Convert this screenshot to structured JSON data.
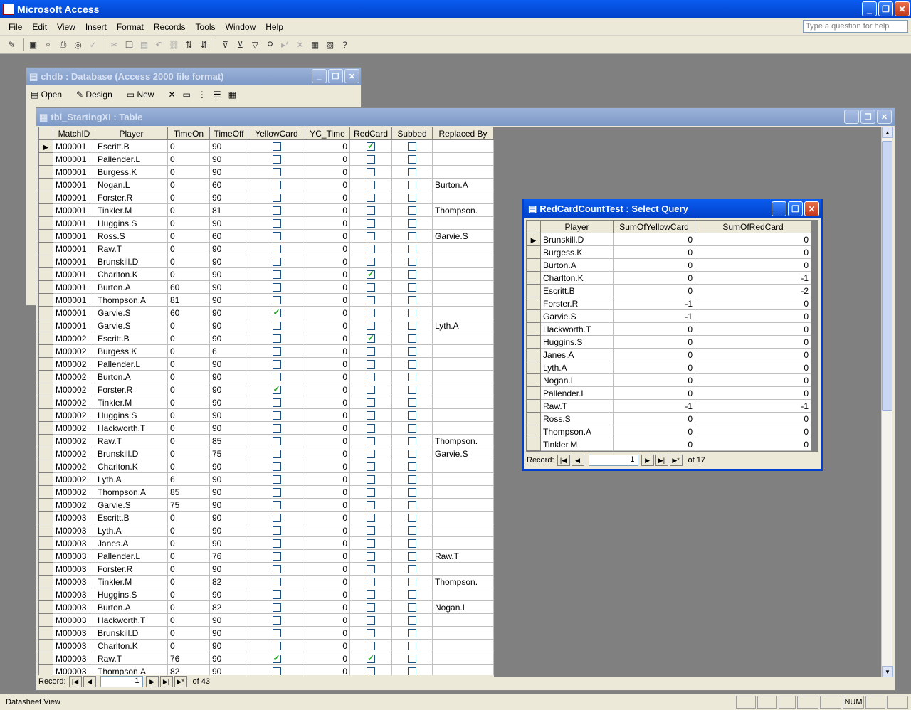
{
  "app": {
    "title": "Microsoft Access"
  },
  "menu": [
    "File",
    "Edit",
    "View",
    "Insert",
    "Format",
    "Records",
    "Tools",
    "Window",
    "Help"
  ],
  "help_placeholder": "Type a question for help",
  "db_window": {
    "title": "chdb : Database (Access 2000 file format)",
    "toolbar": {
      "open": "Open",
      "design": "Design",
      "new": "New"
    }
  },
  "table_window": {
    "title": "tbl_StartingXI : Table",
    "columns": [
      "MatchID",
      "Player",
      "TimeOn",
      "TimeOff",
      "YellowCard",
      "YC_Time",
      "RedCard",
      "Subbed",
      "Replaced By"
    ],
    "rows": [
      [
        "M00001",
        "Escritt.B",
        "0",
        "90",
        false,
        "0",
        true,
        false,
        ""
      ],
      [
        "M00001",
        "Pallender.L",
        "0",
        "90",
        false,
        "0",
        false,
        false,
        ""
      ],
      [
        "M00001",
        "Burgess.K",
        "0",
        "90",
        false,
        "0",
        false,
        false,
        ""
      ],
      [
        "M00001",
        "Nogan.L",
        "0",
        "60",
        false,
        "0",
        false,
        false,
        "Burton.A"
      ],
      [
        "M00001",
        "Forster.R",
        "0",
        "90",
        false,
        "0",
        false,
        false,
        ""
      ],
      [
        "M00001",
        "Tinkler.M",
        "0",
        "81",
        false,
        "0",
        false,
        false,
        "Thompson."
      ],
      [
        "M00001",
        "Huggins.S",
        "0",
        "90",
        false,
        "0",
        false,
        false,
        ""
      ],
      [
        "M00001",
        "Ross.S",
        "0",
        "60",
        false,
        "0",
        false,
        false,
        "Garvie.S"
      ],
      [
        "M00001",
        "Raw.T",
        "0",
        "90",
        false,
        "0",
        false,
        false,
        ""
      ],
      [
        "M00001",
        "Brunskill.D",
        "0",
        "90",
        false,
        "0",
        false,
        false,
        ""
      ],
      [
        "M00001",
        "Charlton.K",
        "0",
        "90",
        false,
        "0",
        true,
        false,
        ""
      ],
      [
        "M00001",
        "Burton.A",
        "60",
        "90",
        false,
        "0",
        false,
        false,
        ""
      ],
      [
        "M00001",
        "Thompson.A",
        "81",
        "90",
        false,
        "0",
        false,
        false,
        ""
      ],
      [
        "M00001",
        "Garvie.S",
        "60",
        "90",
        true,
        "0",
        false,
        false,
        ""
      ],
      [
        "M00001",
        "Garvie.S",
        "0",
        "90",
        false,
        "0",
        false,
        false,
        "Lyth.A"
      ],
      [
        "M00002",
        "Escritt.B",
        "0",
        "90",
        false,
        "0",
        true,
        false,
        ""
      ],
      [
        "M00002",
        "Burgess.K",
        "0",
        "6",
        false,
        "0",
        false,
        false,
        ""
      ],
      [
        "M00002",
        "Pallender.L",
        "0",
        "90",
        false,
        "0",
        false,
        false,
        ""
      ],
      [
        "M00002",
        "Burton.A",
        "0",
        "90",
        false,
        "0",
        false,
        false,
        ""
      ],
      [
        "M00002",
        "Forster.R",
        "0",
        "90",
        true,
        "0",
        false,
        false,
        ""
      ],
      [
        "M00002",
        "Tinkler.M",
        "0",
        "90",
        false,
        "0",
        false,
        false,
        ""
      ],
      [
        "M00002",
        "Huggins.S",
        "0",
        "90",
        false,
        "0",
        false,
        false,
        ""
      ],
      [
        "M00002",
        "Hackworth.T",
        "0",
        "90",
        false,
        "0",
        false,
        false,
        ""
      ],
      [
        "M00002",
        "Raw.T",
        "0",
        "85",
        false,
        "0",
        false,
        false,
        "Thompson."
      ],
      [
        "M00002",
        "Brunskill.D",
        "0",
        "75",
        false,
        "0",
        false,
        false,
        "Garvie.S"
      ],
      [
        "M00002",
        "Charlton.K",
        "0",
        "90",
        false,
        "0",
        false,
        false,
        ""
      ],
      [
        "M00002",
        "Lyth.A",
        "6",
        "90",
        false,
        "0",
        false,
        false,
        ""
      ],
      [
        "M00002",
        "Thompson.A",
        "85",
        "90",
        false,
        "0",
        false,
        false,
        ""
      ],
      [
        "M00002",
        "Garvie.S",
        "75",
        "90",
        false,
        "0",
        false,
        false,
        ""
      ],
      [
        "M00003",
        "Escritt.B",
        "0",
        "90",
        false,
        "0",
        false,
        false,
        ""
      ],
      [
        "M00003",
        "Lyth.A",
        "0",
        "90",
        false,
        "0",
        false,
        false,
        ""
      ],
      [
        "M00003",
        "Janes.A",
        "0",
        "90",
        false,
        "0",
        false,
        false,
        ""
      ],
      [
        "M00003",
        "Pallender.L",
        "0",
        "76",
        false,
        "0",
        false,
        false,
        "Raw.T"
      ],
      [
        "M00003",
        "Forster.R",
        "0",
        "90",
        false,
        "0",
        false,
        false,
        ""
      ],
      [
        "M00003",
        "Tinkler.M",
        "0",
        "82",
        false,
        "0",
        false,
        false,
        "Thompson."
      ],
      [
        "M00003",
        "Huggins.S",
        "0",
        "90",
        false,
        "0",
        false,
        false,
        ""
      ],
      [
        "M00003",
        "Burton.A",
        "0",
        "82",
        false,
        "0",
        false,
        false,
        "Nogan.L"
      ],
      [
        "M00003",
        "Hackworth.T",
        "0",
        "90",
        false,
        "0",
        false,
        false,
        ""
      ],
      [
        "M00003",
        "Brunskill.D",
        "0",
        "90",
        false,
        "0",
        false,
        false,
        ""
      ],
      [
        "M00003",
        "Charlton.K",
        "0",
        "90",
        false,
        "0",
        false,
        false,
        ""
      ],
      [
        "M00003",
        "Raw.T",
        "76",
        "90",
        true,
        "0",
        true,
        false,
        ""
      ],
      [
        "M00003",
        "Thompson.A",
        "82",
        "90",
        false,
        "0",
        false,
        false,
        ""
      ]
    ],
    "nav": {
      "label": "Record:",
      "current": "1",
      "of_label": "of 43"
    }
  },
  "query_window": {
    "title": "RedCardCountTest : Select Query",
    "columns": [
      "Player",
      "SumOfYellowCard",
      "SumOfRedCard"
    ],
    "rows": [
      [
        "Brunskill.D",
        "0",
        "0"
      ],
      [
        "Burgess.K",
        "0",
        "0"
      ],
      [
        "Burton.A",
        "0",
        "0"
      ],
      [
        "Charlton.K",
        "0",
        "-1"
      ],
      [
        "Escritt.B",
        "0",
        "-2"
      ],
      [
        "Forster.R",
        "-1",
        "0"
      ],
      [
        "Garvie.S",
        "-1",
        "0"
      ],
      [
        "Hackworth.T",
        "0",
        "0"
      ],
      [
        "Huggins.S",
        "0",
        "0"
      ],
      [
        "Janes.A",
        "0",
        "0"
      ],
      [
        "Lyth.A",
        "0",
        "0"
      ],
      [
        "Nogan.L",
        "0",
        "0"
      ],
      [
        "Pallender.L",
        "0",
        "0"
      ],
      [
        "Raw.T",
        "-1",
        "-1"
      ],
      [
        "Ross.S",
        "0",
        "0"
      ],
      [
        "Thompson.A",
        "0",
        "0"
      ],
      [
        "Tinkler.M",
        "0",
        "0"
      ]
    ],
    "nav": {
      "label": "Record:",
      "current": "1",
      "of_label": "of  17"
    }
  },
  "status": {
    "text": "Datasheet View",
    "num": "NUM"
  }
}
